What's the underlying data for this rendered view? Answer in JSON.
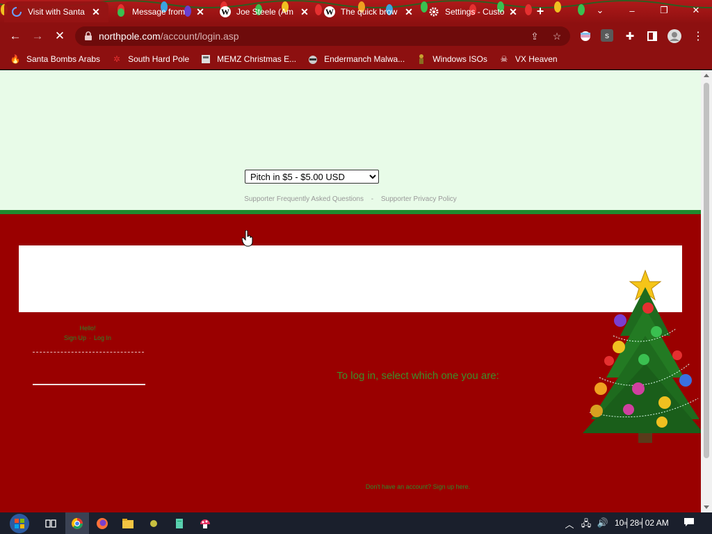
{
  "browser": {
    "tabs": [
      {
        "title": "Visit with Santa",
        "active": true
      },
      {
        "title": "Message from",
        "active": false
      },
      {
        "title": "Joe Steele (Am",
        "active": false
      },
      {
        "title": "The quick brow",
        "active": false
      },
      {
        "title": "Settings - Custo",
        "active": false
      }
    ],
    "wiki_letter": "W",
    "profile_letter": "s",
    "url": {
      "domain": "northpole.com",
      "path": "/account/login.asp"
    }
  },
  "bookmarks": [
    {
      "label": "Santa Bombs Arabs"
    },
    {
      "label": "South Hard Pole"
    },
    {
      "label": "MEMZ Christmas E..."
    },
    {
      "label": "Endermanch Malwa..."
    },
    {
      "label": "Windows ISOs"
    },
    {
      "label": "VX Heaven"
    }
  ],
  "page": {
    "donation": {
      "selected": "Pitch in $5 - $5.00 USD",
      "options": [
        "Pitch in $5 - $5.00 USD"
      ]
    },
    "supporter_links": {
      "faq": "Supporter Frequently Asked Questions",
      "separator": "-",
      "privacy": "Supporter Privacy Policy"
    },
    "hello": "Hello!",
    "auth": {
      "signup": "Sign Up",
      "separator": "-",
      "login": "Log In"
    },
    "login_prompt": "To log in, select which one you are:",
    "signup_prompt": "Don't have an account? Sign up here."
  },
  "taskbar": {
    "clock": "10╡28╡02 AM"
  },
  "colors": {
    "chrome": "#8d1010",
    "page_top": "#e8fbe8",
    "page_red": "#9a0000",
    "divider_green": "#1f8a2e",
    "link_green": "#2b8a2b"
  }
}
